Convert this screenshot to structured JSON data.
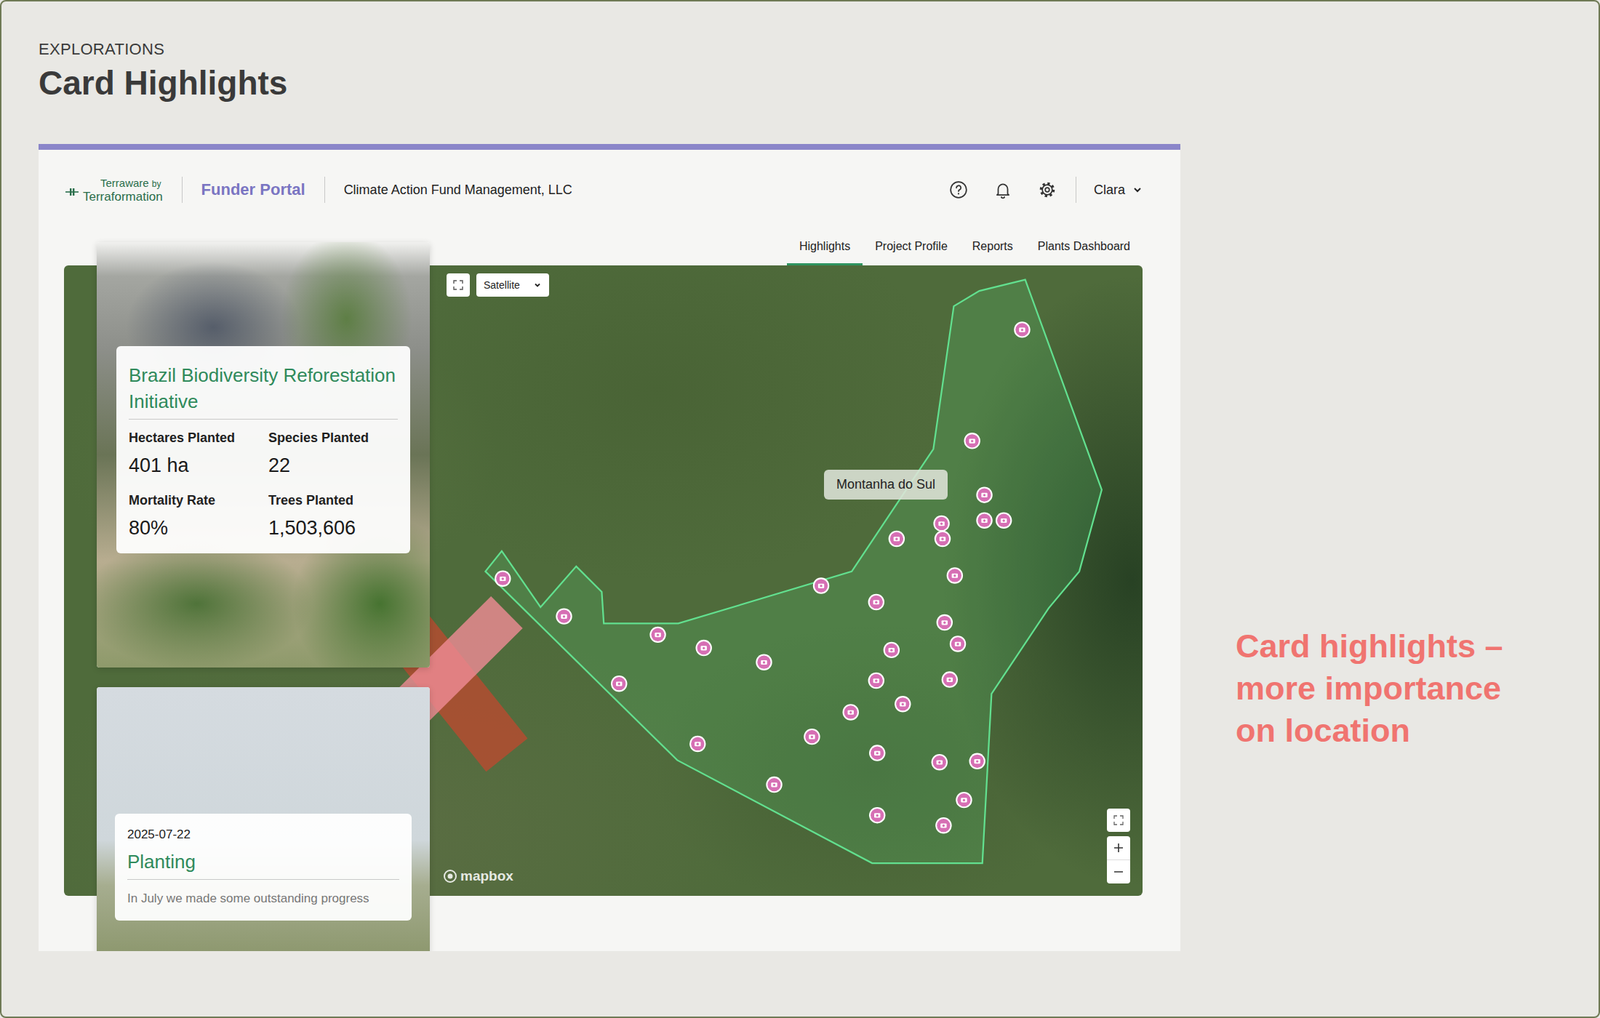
{
  "page": {
    "section": "EXPLORATIONS",
    "title": "Card Highlights",
    "annotation": [
      "Card highlights –",
      "more importance",
      "on location"
    ]
  },
  "header": {
    "logo": {
      "product": "Terraware",
      "by": "by",
      "company": "Terraformation"
    },
    "portal": "Funder Portal",
    "organization": "Climate Action Fund Management, LLC",
    "user": "Clara"
  },
  "tabs": [
    {
      "label": "Highlights",
      "selected": true
    },
    {
      "label": "Project Profile",
      "selected": false
    },
    {
      "label": "Reports",
      "selected": false
    },
    {
      "label": "Plants Dashboard",
      "selected": false
    }
  ],
  "project_card": {
    "title": "Brazil Biodiversity Reforestation Initiative",
    "stats": [
      {
        "label": "Hectares Planted",
        "value": "401 ha"
      },
      {
        "label": "Species Planted",
        "value": "22"
      },
      {
        "label": "Mortality Rate",
        "value": "80%"
      },
      {
        "label": "Trees Planted",
        "value": "1,503,606"
      }
    ]
  },
  "update_card": {
    "date": "2025-07-22",
    "title": "Planting",
    "excerpt": "In July we made some outstanding progress"
  },
  "map": {
    "style": "Satellite",
    "site_label": "Montanha do Sul",
    "attribution": "mapbox"
  }
}
